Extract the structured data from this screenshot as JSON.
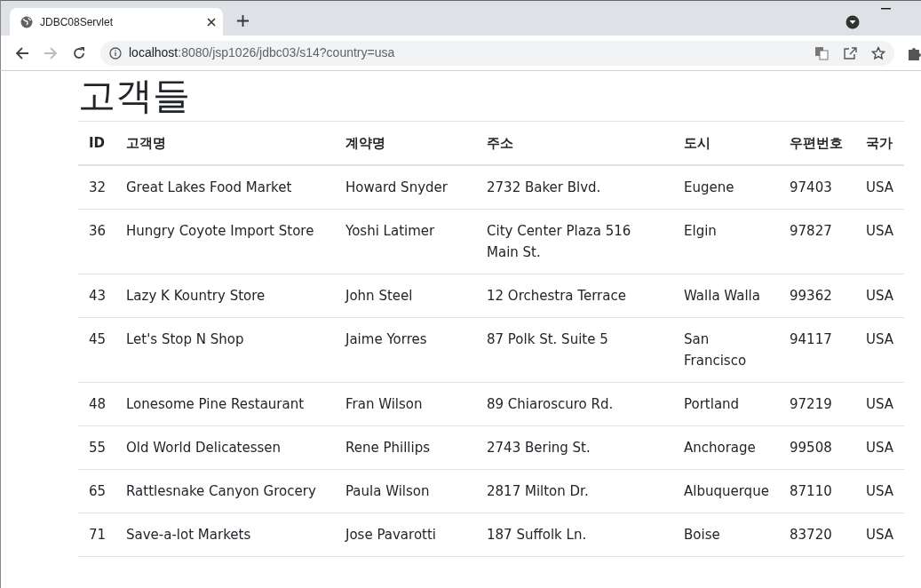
{
  "browser": {
    "tab_title": "JDBC08Servlet",
    "url_host": "localhost",
    "url_rest": ":8080/jsp1026/jdbc03/s14?country=usa"
  },
  "page": {
    "heading": "고객들"
  },
  "table": {
    "columns": [
      "ID",
      "고객명",
      "계약명",
      "주소",
      "도시",
      "우편번호",
      "국가"
    ],
    "rows": [
      [
        "32",
        "Great Lakes Food Market",
        "Howard Snyder",
        "2732 Baker Blvd.",
        "Eugene",
        "97403",
        "USA"
      ],
      [
        "36",
        "Hungry Coyote Import Store",
        "Yoshi Latimer",
        "City Center Plaza 516 Main St.",
        "Elgin",
        "97827",
        "USA"
      ],
      [
        "43",
        "Lazy K Kountry Store",
        "John Steel",
        "12 Orchestra Terrace",
        "Walla Walla",
        "99362",
        "USA"
      ],
      [
        "45",
        "Let's Stop N Shop",
        "Jaime Yorres",
        "87 Polk St. Suite 5",
        "San Francisco",
        "94117",
        "USA"
      ],
      [
        "48",
        "Lonesome Pine Restaurant",
        "Fran Wilson",
        "89 Chiaroscuro Rd.",
        "Portland",
        "97219",
        "USA"
      ],
      [
        "55",
        "Old World Delicatessen",
        "Rene Phillips",
        "2743 Bering St.",
        "Anchorage",
        "99508",
        "USA"
      ],
      [
        "65",
        "Rattlesnake Canyon Grocery",
        "Paula Wilson",
        "2817 Milton Dr.",
        "Albuquerque",
        "87110",
        "USA"
      ],
      [
        "71",
        "Save-a-lot Markets",
        "Jose Pavarotti",
        "187 Suffolk Ln.",
        "Boise",
        "83720",
        "USA"
      ]
    ]
  }
}
